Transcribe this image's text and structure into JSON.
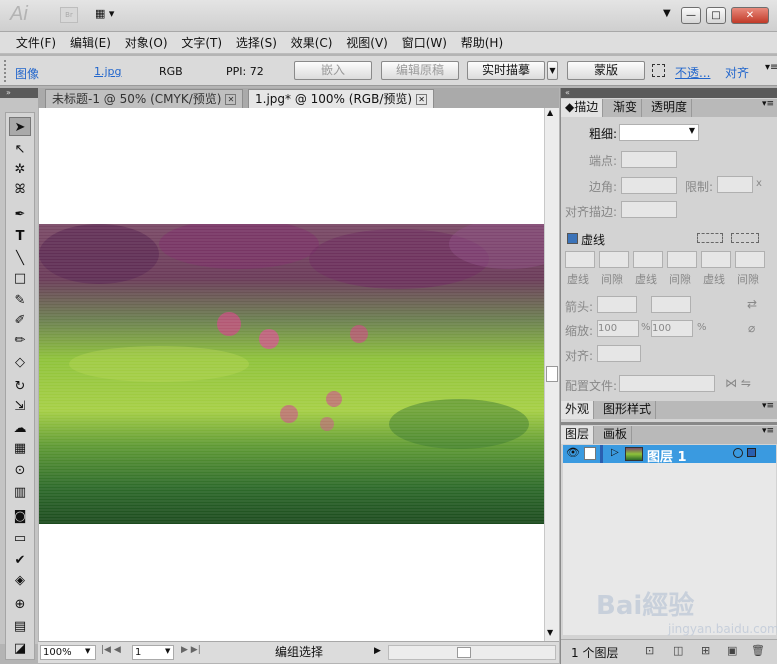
{
  "app": {
    "logo": "Ai",
    "bridge": "Br",
    "arrange": "▦ ▾"
  },
  "window": {
    "minimize": "—",
    "maximize": "□",
    "close": "✕"
  },
  "menu": [
    "文件(F)",
    "编辑(E)",
    "对象(O)",
    "文字(T)",
    "选择(S)",
    "效果(C)",
    "视图(V)",
    "窗口(W)",
    "帮助(H)"
  ],
  "control": {
    "kind": "图像",
    "file": "1.jpg",
    "mode": "RGB",
    "ppi": "PPI: 72",
    "embed": "嵌入",
    "edit_original": "编辑原稿",
    "live_trace": "实时描摹",
    "mask": "蒙版",
    "opacity": "不透...",
    "align": "对齐"
  },
  "tabs": [
    {
      "label": "未标题-1 @ 50% (CMYK/预览)",
      "active": false
    },
    {
      "label": "1.jpg* @ 100% (RGB/预览)",
      "active": true
    }
  ],
  "tools": [
    "➤",
    "↖",
    "✲",
    "ꕤ",
    "✒",
    "T",
    "╲",
    "□",
    "✎",
    "✐",
    "✏",
    "◇",
    "↻",
    "⇲",
    "☁",
    "▦",
    "⊙",
    "▥",
    "◙",
    "▭",
    "✔",
    "◈",
    "⊕",
    "▤",
    "◪"
  ],
  "stroke_panel": {
    "tabs": [
      "描边",
      "渐变",
      "透明度"
    ],
    "weight": "粗细:",
    "cap": "端点:",
    "corner": "边角:",
    "limit": "限制:",
    "limit_val": "x",
    "align_stroke": "对齐描边:",
    "dashed": "虚线",
    "dash_labels": [
      "虚线",
      "间隙",
      "虚线",
      "间隙",
      "虚线",
      "间隙"
    ],
    "arrows": "箭头:",
    "scale": "缩放:",
    "scale1": "100",
    "scale2": "100",
    "pct": "%",
    "align": "对齐:",
    "profile": "配置文件:"
  },
  "appearance_tabs": [
    "外观",
    "图形样式"
  ],
  "layers_tabs": [
    "图层",
    "画板"
  ],
  "layer_name": "图层 1",
  "layers_count": "1 个图层",
  "status": {
    "zoom": "100%",
    "page": "1",
    "mode": "编组选择"
  },
  "watermark": "Bai經验",
  "watermark_url": "jingyan.baidu.com"
}
